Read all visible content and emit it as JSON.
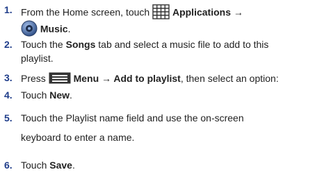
{
  "steps": [
    {
      "num": "1.",
      "line1": {
        "t1": "From the Home screen, touch ",
        "icon": "applications-grid-icon",
        "t2": " ",
        "bold": "Applications →"
      },
      "line2": {
        "icon": "music-icon",
        "t1": " ",
        "bold": "Music",
        "t2": "."
      }
    },
    {
      "num": "2.",
      "line1": {
        "t1": "Touch the ",
        "bold": "Songs",
        "t2": " tab and select a music file to add to this"
      },
      "line2": {
        "t1": "playlist."
      }
    },
    {
      "num": "3.",
      "line1": {
        "t1": "Press ",
        "icon": "menu-icon",
        "t2": " ",
        "bold": "Menu → Add to playlist",
        "t3": ", then select an option:"
      }
    },
    {
      "num": "4.",
      "line1": {
        "t1": "Touch ",
        "bold": "New",
        "t2": "."
      }
    },
    {
      "num": "5.",
      "line1": {
        "t1": "Touch the Playlist name field and use the on-screen"
      },
      "line2": {
        "t1": "keyboard to enter a name."
      }
    },
    {
      "num": "6.",
      "line1": {
        "t1": "Touch ",
        "bold": "Save",
        "t2": "."
      }
    }
  ],
  "colors": {
    "step_number": "#1f3d8a",
    "text": "#222222",
    "icon_dark": "#333333",
    "music_icon_blue": "#4a6ea8"
  }
}
